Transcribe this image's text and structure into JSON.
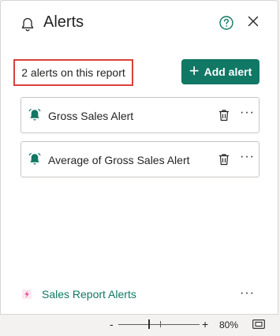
{
  "header": {
    "title": "Alerts"
  },
  "summary": {
    "count_text": "2 alerts on this report"
  },
  "actions": {
    "add_alert_label": "Add alert",
    "add_icon": "+"
  },
  "alerts": [
    {
      "name": "Gross Sales Alert",
      "more": "···"
    },
    {
      "name": "Average of Gross Sales Alert",
      "more": "···"
    }
  ],
  "footer": {
    "report_name": "Sales Report Alerts",
    "more": "···"
  },
  "zoom": {
    "minus": "-",
    "plus": "+",
    "level": "80%"
  },
  "colors": {
    "accent": "#117865",
    "highlight_border": "#d9413b",
    "report_icon": "#e33b8e"
  },
  "icons": [
    "bell-icon",
    "help-icon",
    "close-icon",
    "alert-bell-icon",
    "trash-icon",
    "more-icon",
    "report-icon",
    "fit-to-page-icon"
  ]
}
